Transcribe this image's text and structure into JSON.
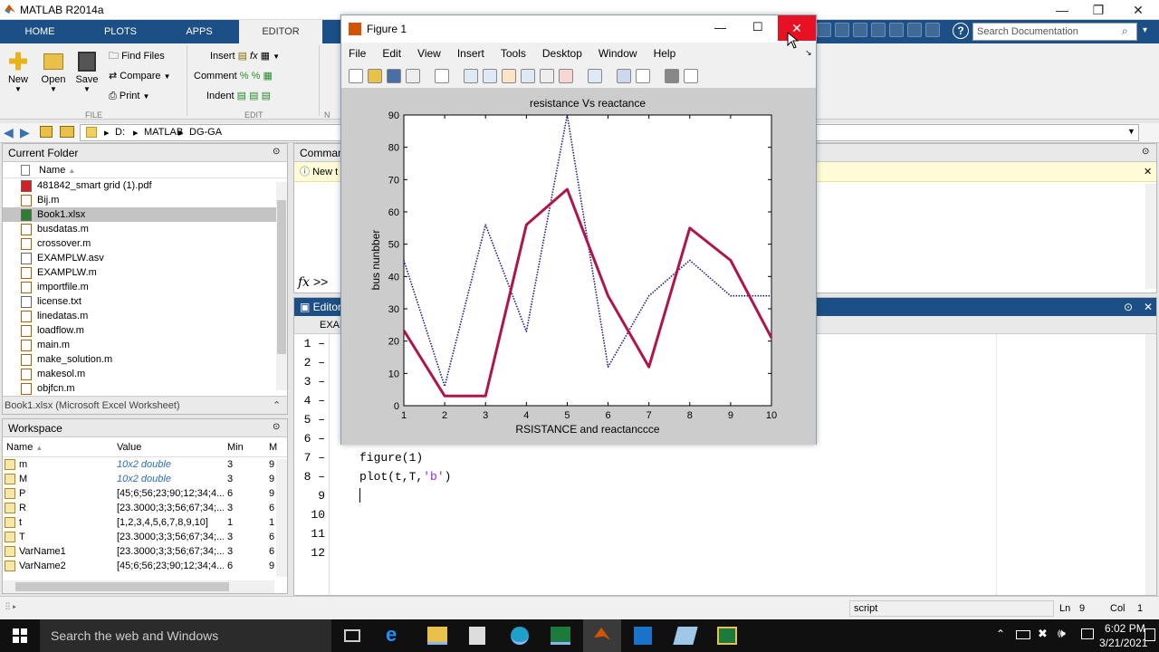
{
  "app": {
    "title": "MATLAB R2014a"
  },
  "tabs": [
    "HOME",
    "PLOTS",
    "APPS",
    "EDITOR"
  ],
  "ribbon": {
    "new": "New",
    "open": "Open",
    "save": "Save",
    "find_files": "Find Files",
    "compare": "Compare",
    "print": "Print",
    "insert": "Insert",
    "comment": "Comment",
    "indent": "Indent",
    "file_section": "FILE",
    "edit_section": "EDIT",
    "nav_section": "N",
    "search_placeholder": "Search Documentation"
  },
  "path": [
    "D:",
    "MATLAB",
    "DG-GA"
  ],
  "current_folder": {
    "title": "Current Folder",
    "name_header": "Name",
    "files": [
      "481842_smart grid (1).pdf",
      "Bij.m",
      "Book1.xlsx",
      "busdatas.m",
      "crossover.m",
      "EXAMPLW.asv",
      "EXAMPLW.m",
      "importfile.m",
      "license.txt",
      "linedatas.m",
      "loadflow.m",
      "main.m",
      "make_solution.m",
      "makesol.m",
      "objfcn.m"
    ],
    "selected": "Book1.xlsx",
    "details": "Book1.xlsx (Microsoft Excel Worksheet)"
  },
  "workspace": {
    "title": "Workspace",
    "headers": [
      "Name",
      "Value",
      "Min",
      "M"
    ],
    "rows": [
      {
        "name": "m",
        "value": "10x2 double",
        "min": "3",
        "max": "9"
      },
      {
        "name": "M",
        "value": "10x2 double",
        "min": "3",
        "max": "9"
      },
      {
        "name": "P",
        "value": "[45;6;56;23;90;12;34;4...",
        "min": "6",
        "max": "9"
      },
      {
        "name": "R",
        "value": "[23.3000;3;3;56;67;34;...",
        "min": "3",
        "max": "6"
      },
      {
        "name": "t",
        "value": "[1,2,3,4,5,6,7,8,9,10]",
        "min": "1",
        "max": "1"
      },
      {
        "name": "T",
        "value": "[23.3000;3;3;56;67;34;...",
        "min": "3",
        "max": "6"
      },
      {
        "name": "VarName1",
        "value": "[23.3000;3;3;56;67;34;...",
        "min": "3",
        "max": "6"
      },
      {
        "name": "VarName2",
        "value": "[45;6;56;23;90;12;34;4...",
        "min": "6",
        "max": "9"
      }
    ]
  },
  "command_window": {
    "title": "Command",
    "notice": "New t",
    "prompt": ">>"
  },
  "editor": {
    "title": "Editor",
    "tab": "EXAM",
    "line_numbers": [
      "1",
      "2",
      "3",
      "4",
      "5",
      "6",
      "7",
      "8",
      "9",
      "10",
      "11",
      "12"
    ],
    "line7": "figure(1)",
    "line8_a": "plot(t,T,",
    "line8_str": "'b'",
    "line8_b": ")"
  },
  "figure": {
    "title": "Figure 1",
    "menus": [
      "File",
      "Edit",
      "View",
      "Insert",
      "Tools",
      "Desktop",
      "Window",
      "Help"
    ]
  },
  "chart_data": {
    "type": "line",
    "title": "resistance Vs reactance",
    "xlabel": "RSISTANCE and reactanccce",
    "ylabel": "bus nunbber",
    "xlim": [
      1,
      10
    ],
    "ylim": [
      0,
      90
    ],
    "xticks": [
      1,
      2,
      3,
      4,
      5,
      6,
      7,
      8,
      9,
      10
    ],
    "yticks": [
      0,
      10,
      20,
      30,
      40,
      50,
      60,
      70,
      80,
      90
    ],
    "x": [
      1,
      2,
      3,
      4,
      5,
      6,
      7,
      8,
      9,
      10
    ],
    "series": [
      {
        "values": [
          45,
          6,
          56,
          23,
          90,
          12,
          34,
          45,
          34,
          34
        ],
        "color": "#1a1a8c",
        "style": "dotted"
      },
      {
        "values": [
          23.3,
          3,
          3,
          56,
          67,
          34,
          12,
          55,
          45,
          21
        ],
        "color": "#b0154a",
        "style": "solid"
      }
    ],
    "grid": false
  },
  "status": {
    "mode": "script",
    "ln_label": "Ln",
    "ln": "9",
    "col_label": "Col",
    "col": "1"
  },
  "taskbar": {
    "search": "Search the web and Windows",
    "time": "6:02 PM",
    "date": "3/21/2021"
  },
  "colors": {
    "ribbon_tab": "#1c4f86",
    "close": "#e81123",
    "taskbar": "#101010"
  }
}
